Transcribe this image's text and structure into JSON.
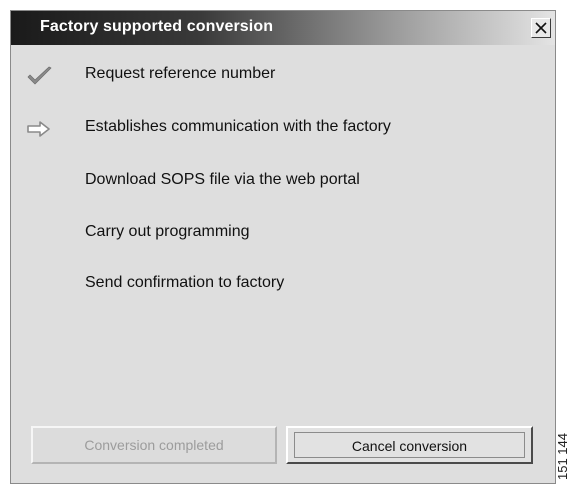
{
  "dialog": {
    "title": "Factory supported conversion",
    "close_label": "X"
  },
  "steps": [
    {
      "label": "Request reference number",
      "status": "done",
      "icon": "checkmark-icon"
    },
    {
      "label": "Establishes communication with the factory",
      "status": "current",
      "icon": "arrow-right-icon"
    },
    {
      "label": "Download SOPS file via the web portal",
      "status": "pending",
      "icon": ""
    },
    {
      "label": "Carry out programming",
      "status": "pending",
      "icon": ""
    },
    {
      "label": "Send confirmation to factory",
      "status": "pending",
      "icon": ""
    }
  ],
  "buttons": {
    "conversion_completed": "Conversion completed",
    "cancel_conversion": "Cancel conversion"
  },
  "figure_code": "151 144",
  "colors": {
    "dialog_bg": "#dedede",
    "titlebar_dark": "#1a1a1a",
    "icon_gray": "#8a8a8a",
    "disabled_text": "#9c9c9c"
  }
}
